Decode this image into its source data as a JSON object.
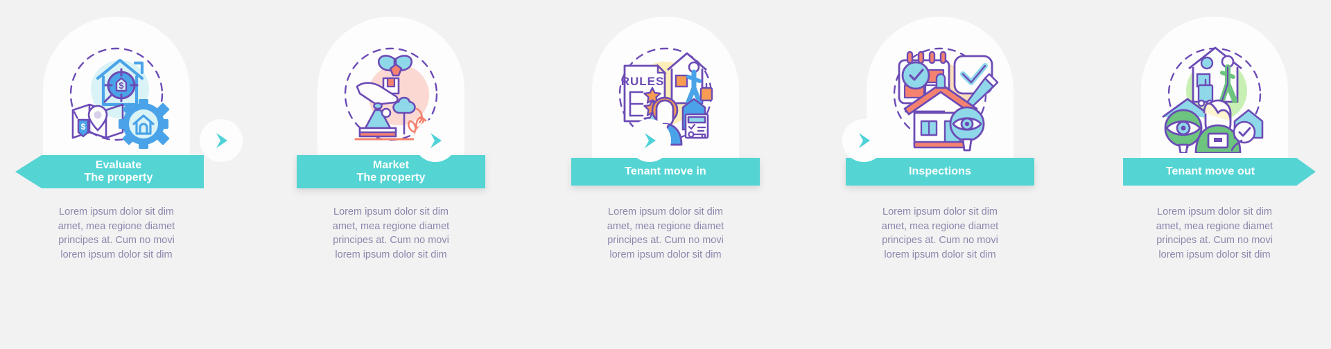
{
  "theme": {
    "background": "#f2f2f2",
    "card": "#fdfdfd",
    "banner": "#55d4d4",
    "banner_text": "#ffffff",
    "body_text": "#8d86ad",
    "accent_purple": "#6c4bb6",
    "accent_blue": "#4aa3e8",
    "accent_coral": "#f4826e",
    "accent_orange": "#f79c52",
    "accent_green": "#6cc47f",
    "accent_yellow": "#f7d96b"
  },
  "body_lines": [
    "Lorem ipsum dolor sit dim",
    "amet, mea regione diamet",
    "principes at. Cum no movi",
    "lorem ipsum dolor sit dim"
  ],
  "steps": [
    {
      "id": "evaluate-the-property",
      "title_line1": "Evaluate",
      "title_line2": "The property",
      "icon_name": "house-valuation-icon",
      "banner_shape": "first",
      "backdrop": "#d9f3f7",
      "body": [
        "Lorem ipsum dolor sit dim",
        "amet, mea regione diamet",
        "principes at. Cum no movi",
        "lorem ipsum dolor sit dim"
      ]
    },
    {
      "id": "market-the-property",
      "title_line1": "Market",
      "title_line2": "The property",
      "icon_name": "gift-house-marketing-icon",
      "banner_shape": "mid",
      "backdrop": "#fbd9d2",
      "body": [
        "Lorem ipsum dolor sit dim",
        "amet, mea regione diamet",
        "principes at. Cum no movi",
        "lorem ipsum dolor sit dim"
      ]
    },
    {
      "id": "tenant-move-in",
      "title_line1": "Tenant move in",
      "title_line2": "",
      "icon_name": "rules-tenant-movein-icon",
      "banner_shape": "mid",
      "backdrop": "#fbeeb8",
      "body": [
        "Lorem ipsum dolor sit dim",
        "amet, mea regione diamet",
        "principes at. Cum no movi",
        "lorem ipsum dolor sit dim"
      ]
    },
    {
      "id": "inspections",
      "title_line1": "Inspections",
      "title_line2": "",
      "icon_name": "calendar-inspection-icon",
      "banner_shape": "mid",
      "backdrop": "#fbddbc",
      "body": [
        "Lorem ipsum dolor sit dim",
        "amet, mea regione diamet",
        "principes at. Cum no movi",
        "lorem ipsum dolor sit dim"
      ]
    },
    {
      "id": "tenant-move-out",
      "title_line1": "Tenant move out",
      "title_line2": "",
      "icon_name": "tenant-moveout-icon",
      "banner_shape": "last",
      "backdrop": "#c9f0b4",
      "body": [
        "Lorem ipsum dolor sit dim",
        "amet, mea regione diamet",
        "principes at. Cum no movi",
        "lorem ipsum dolor sit dim"
      ]
    }
  ],
  "connectors": [
    {
      "name": "chevron-right-icon-1"
    },
    {
      "name": "chevron-right-icon-2"
    },
    {
      "name": "chevron-right-icon-3"
    },
    {
      "name": "chevron-right-icon-4"
    }
  ]
}
